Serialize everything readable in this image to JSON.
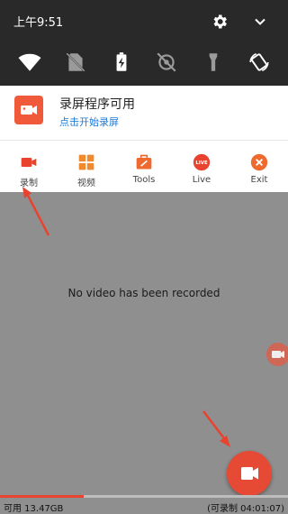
{
  "status_bar": {
    "time": "上午9:51",
    "icons": [
      "gear-icon",
      "chevron-down-icon"
    ]
  },
  "quick_settings": [
    "wifi-icon",
    "no-sim-icon",
    "battery-charging-icon",
    "location-off-icon",
    "flashlight-icon",
    "auto-rotate-icon"
  ],
  "notification": {
    "title": "录屏程序可用",
    "subtitle": "点击开始录屏",
    "icon": "video-camera-icon",
    "accent": "#f0593a"
  },
  "actions": [
    {
      "label": "录制",
      "icon": "record-icon"
    },
    {
      "label": "视频",
      "icon": "grid-icon"
    },
    {
      "label": "Tools",
      "icon": "toolbox-icon"
    },
    {
      "label": "Live",
      "icon": "live-icon"
    },
    {
      "label": "Exit",
      "icon": "close-icon"
    }
  ],
  "main": {
    "empty_message": "No video has been recorded"
  },
  "footer": {
    "storage_available": "可用 13.47GB",
    "recordable_time": "(可录制 04:01:07)",
    "storage_fill_fraction": 0.29
  },
  "colors": {
    "accent": "#e64a35",
    "status_bg": "#292929",
    "overlay": "#8f8f8f"
  }
}
